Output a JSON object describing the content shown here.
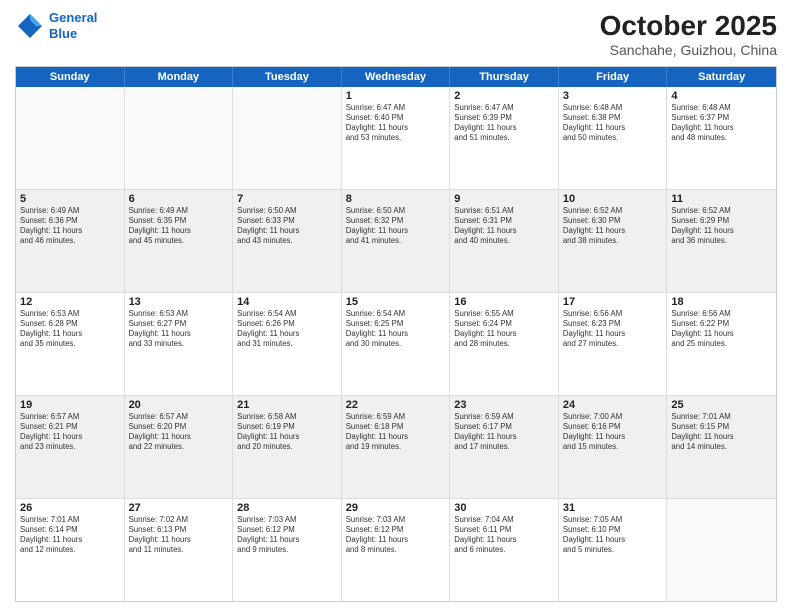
{
  "header": {
    "logo_line1": "General",
    "logo_line2": "Blue",
    "month": "October 2025",
    "location": "Sanchahe, Guizhou, China"
  },
  "days_of_week": [
    "Sunday",
    "Monday",
    "Tuesday",
    "Wednesday",
    "Thursday",
    "Friday",
    "Saturday"
  ],
  "weeks": [
    [
      {
        "day": "",
        "info": ""
      },
      {
        "day": "",
        "info": ""
      },
      {
        "day": "",
        "info": ""
      },
      {
        "day": "1",
        "info": "Sunrise: 6:47 AM\nSunset: 6:40 PM\nDaylight: 11 hours\nand 53 minutes."
      },
      {
        "day": "2",
        "info": "Sunrise: 6:47 AM\nSunset: 6:39 PM\nDaylight: 11 hours\nand 51 minutes."
      },
      {
        "day": "3",
        "info": "Sunrise: 6:48 AM\nSunset: 6:38 PM\nDaylight: 11 hours\nand 50 minutes."
      },
      {
        "day": "4",
        "info": "Sunrise: 6:48 AM\nSunset: 6:37 PM\nDaylight: 11 hours\nand 48 minutes."
      }
    ],
    [
      {
        "day": "5",
        "info": "Sunrise: 6:49 AM\nSunset: 6:36 PM\nDaylight: 11 hours\nand 46 minutes."
      },
      {
        "day": "6",
        "info": "Sunrise: 6:49 AM\nSunset: 6:35 PM\nDaylight: 11 hours\nand 45 minutes."
      },
      {
        "day": "7",
        "info": "Sunrise: 6:50 AM\nSunset: 6:33 PM\nDaylight: 11 hours\nand 43 minutes."
      },
      {
        "day": "8",
        "info": "Sunrise: 6:50 AM\nSunset: 6:32 PM\nDaylight: 11 hours\nand 41 minutes."
      },
      {
        "day": "9",
        "info": "Sunrise: 6:51 AM\nSunset: 6:31 PM\nDaylight: 11 hours\nand 40 minutes."
      },
      {
        "day": "10",
        "info": "Sunrise: 6:52 AM\nSunset: 6:30 PM\nDaylight: 11 hours\nand 38 minutes."
      },
      {
        "day": "11",
        "info": "Sunrise: 6:52 AM\nSunset: 6:29 PM\nDaylight: 11 hours\nand 36 minutes."
      }
    ],
    [
      {
        "day": "12",
        "info": "Sunrise: 6:53 AM\nSunset: 6:28 PM\nDaylight: 11 hours\nand 35 minutes."
      },
      {
        "day": "13",
        "info": "Sunrise: 6:53 AM\nSunset: 6:27 PM\nDaylight: 11 hours\nand 33 minutes."
      },
      {
        "day": "14",
        "info": "Sunrise: 6:54 AM\nSunset: 6:26 PM\nDaylight: 11 hours\nand 31 minutes."
      },
      {
        "day": "15",
        "info": "Sunrise: 6:54 AM\nSunset: 6:25 PM\nDaylight: 11 hours\nand 30 minutes."
      },
      {
        "day": "16",
        "info": "Sunrise: 6:55 AM\nSunset: 6:24 PM\nDaylight: 11 hours\nand 28 minutes."
      },
      {
        "day": "17",
        "info": "Sunrise: 6:56 AM\nSunset: 6:23 PM\nDaylight: 11 hours\nand 27 minutes."
      },
      {
        "day": "18",
        "info": "Sunrise: 6:56 AM\nSunset: 6:22 PM\nDaylight: 11 hours\nand 25 minutes."
      }
    ],
    [
      {
        "day": "19",
        "info": "Sunrise: 6:57 AM\nSunset: 6:21 PM\nDaylight: 11 hours\nand 23 minutes."
      },
      {
        "day": "20",
        "info": "Sunrise: 6:57 AM\nSunset: 6:20 PM\nDaylight: 11 hours\nand 22 minutes."
      },
      {
        "day": "21",
        "info": "Sunrise: 6:58 AM\nSunset: 6:19 PM\nDaylight: 11 hours\nand 20 minutes."
      },
      {
        "day": "22",
        "info": "Sunrise: 6:59 AM\nSunset: 6:18 PM\nDaylight: 11 hours\nand 19 minutes."
      },
      {
        "day": "23",
        "info": "Sunrise: 6:59 AM\nSunset: 6:17 PM\nDaylight: 11 hours\nand 17 minutes."
      },
      {
        "day": "24",
        "info": "Sunrise: 7:00 AM\nSunset: 6:16 PM\nDaylight: 11 hours\nand 15 minutes."
      },
      {
        "day": "25",
        "info": "Sunrise: 7:01 AM\nSunset: 6:15 PM\nDaylight: 11 hours\nand 14 minutes."
      }
    ],
    [
      {
        "day": "26",
        "info": "Sunrise: 7:01 AM\nSunset: 6:14 PM\nDaylight: 11 hours\nand 12 minutes."
      },
      {
        "day": "27",
        "info": "Sunrise: 7:02 AM\nSunset: 6:13 PM\nDaylight: 11 hours\nand 11 minutes."
      },
      {
        "day": "28",
        "info": "Sunrise: 7:03 AM\nSunset: 6:12 PM\nDaylight: 11 hours\nand 9 minutes."
      },
      {
        "day": "29",
        "info": "Sunrise: 7:03 AM\nSunset: 6:12 PM\nDaylight: 11 hours\nand 8 minutes."
      },
      {
        "day": "30",
        "info": "Sunrise: 7:04 AM\nSunset: 6:11 PM\nDaylight: 11 hours\nand 6 minutes."
      },
      {
        "day": "31",
        "info": "Sunrise: 7:05 AM\nSunset: 6:10 PM\nDaylight: 11 hours\nand 5 minutes."
      },
      {
        "day": "",
        "info": ""
      }
    ]
  ]
}
